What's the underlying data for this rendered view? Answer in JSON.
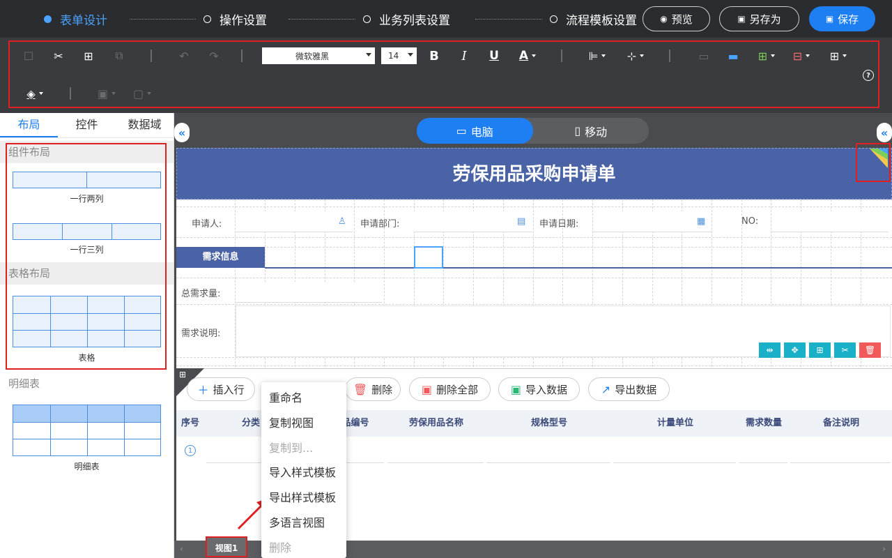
{
  "steps": [
    {
      "label": "表单设计"
    },
    {
      "label": "操作设置"
    },
    {
      "label": "业务列表设置"
    },
    {
      "label": "流程模板设置"
    }
  ],
  "top_buttons": {
    "preview": "预览",
    "save_as": "另存为",
    "save": "保存"
  },
  "toolbar": {
    "font": "微软雅黑",
    "size": "14",
    "bold": "B",
    "italic": "I",
    "underline": "U",
    "font_color": "A",
    "help": "?"
  },
  "left_panel": {
    "tabs": [
      "布局",
      "控件",
      "数据域"
    ],
    "sections": {
      "component_layout": "组件布局",
      "table_layout": "表格布局",
      "detail_table": "明细表"
    },
    "items": {
      "one_row_two": "一行两列",
      "one_row_three": "一行三列",
      "table": "表格",
      "detail": "明细表"
    }
  },
  "view_switch": {
    "desktop": "电脑",
    "mobile": "移动"
  },
  "form": {
    "title": "劳保用品采购申请单",
    "fields": {
      "applicant": "申请人:",
      "department": "申请部门:",
      "date": "申请日期:",
      "no": "NO:"
    },
    "section": "需求信息",
    "total_qty": "总需求量:",
    "description": "需求说明:"
  },
  "detail": {
    "buttons": {
      "insert_row": "插入行",
      "delete": "删除",
      "delete_all": "删除全部",
      "import": "导入数据",
      "export": "导出数据"
    },
    "columns": [
      "序号",
      "分类",
      "品编号",
      "劳保用品名称",
      "规格型号",
      "计量单位",
      "需求数量",
      "备注说明"
    ],
    "row_number": "1"
  },
  "view_tab": "视图1",
  "context_menu": [
    {
      "label": "重命名",
      "disabled": false
    },
    {
      "label": "复制视图",
      "disabled": false
    },
    {
      "label": "复制到...",
      "disabled": true
    },
    {
      "label": "导入样式模板",
      "disabled": false
    },
    {
      "label": "导出样式模板",
      "disabled": false
    },
    {
      "label": "多语言视图",
      "disabled": false
    },
    {
      "label": "删除",
      "disabled": true
    }
  ],
  "colors": {
    "accent": "#1d7ff2",
    "header_bg": "#2b2c2f",
    "form_title_bg": "#4a62a6",
    "highlight": "#e02020"
  }
}
